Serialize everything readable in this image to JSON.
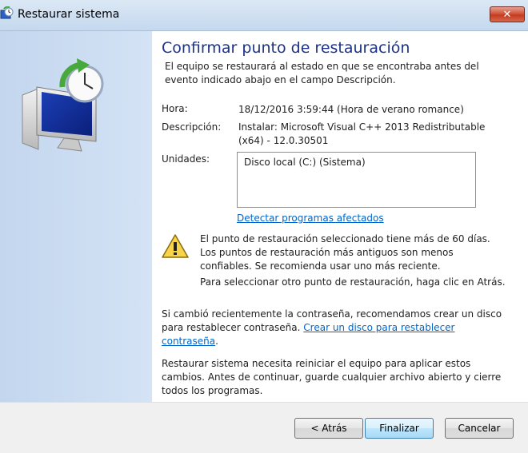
{
  "window": {
    "title": "Restaurar sistema",
    "close_label": "✕"
  },
  "main": {
    "heading": "Confirmar punto de restauración",
    "subtitle": "El equipo se restaurará al estado en que se encontraba antes del evento indicado abajo en el campo Descripción.",
    "hora_label": "Hora:",
    "hora_value": "18/12/2016 3:59:44 (Hora de verano romance)",
    "descripcion_label": "Descripción:",
    "descripcion_value": "Instalar: Microsoft Visual C++ 2013 Redistributable (x64) - 12.0.30501",
    "unidades_label": "Unidades:",
    "unidades_items": [
      "Disco local (C:) (Sistema)"
    ],
    "detect_link": "Detectar programas afectados",
    "warning_text": "El punto de restauración seleccionado tiene más de 60 días. Los puntos de restauración más antiguos son menos confiables. Se recomienda usar uno más reciente.",
    "back_hint": "Para seleccionar otro punto de restauración, haga clic en Atrás.",
    "password_text": "Si cambió recientemente la contraseña, recomendamos crear un disco para restablecer contraseña.",
    "password_link": "Crear un disco para restablecer contraseña",
    "restart_text": "Restaurar sistema necesita reiniciar el equipo para aplicar estos cambios. Antes de continuar, guarde cualquier archivo abierto y cierre todos los programas."
  },
  "buttons": {
    "back": "< Atrás",
    "finish": "Finalizar",
    "cancel": "Cancelar"
  },
  "icons": {
    "title": "system-restore-icon",
    "hero": "system-restore-monitor-icon",
    "warning": "warning-icon"
  },
  "colors": {
    "heading": "#1e3287",
    "link": "#0066cc",
    "close": "#c53a20"
  }
}
